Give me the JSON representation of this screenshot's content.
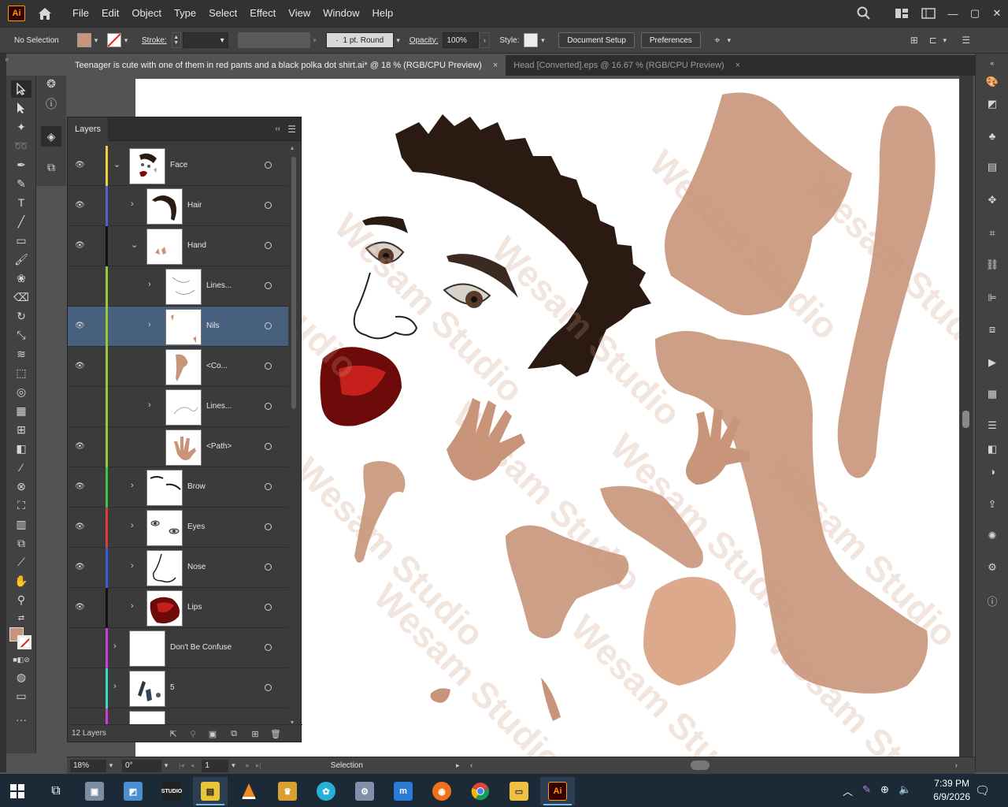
{
  "menubar": {
    "app_logo": "Ai",
    "items": [
      "File",
      "Edit",
      "Object",
      "Type",
      "Select",
      "Effect",
      "View",
      "Window",
      "Help"
    ]
  },
  "controlbar": {
    "selection_label": "No Selection",
    "fill_color": "#c8957a",
    "stroke_label": "Stroke:",
    "stroke_profile": "1 pt. Round",
    "opacity_label": "Opacity:",
    "opacity_value": "100%",
    "style_label": "Style:",
    "document_setup": "Document Setup",
    "preferences": "Preferences"
  },
  "tabs": [
    {
      "label": "Teenager is cute with one of them in red pants and a black polka dot shirt.ai* @ 18 % (RGB/CPU Preview)",
      "close": "×"
    },
    {
      "label": "Head [Converted].eps @ 16.67 % (RGB/CPU Preview)",
      "close": "×"
    }
  ],
  "layers_panel": {
    "title": "Layers",
    "footer_count": "12 Layers",
    "rows": [
      {
        "name": "Face"
      },
      {
        "name": "Hair"
      },
      {
        "name": "Hand"
      },
      {
        "name": "Lines..."
      },
      {
        "name": "Nils"
      },
      {
        "name": "<Co..."
      },
      {
        "name": "Lines..."
      },
      {
        "name": "<Path>"
      },
      {
        "name": "Brow"
      },
      {
        "name": "Eyes"
      },
      {
        "name": "Nose"
      },
      {
        "name": "Lips"
      },
      {
        "name": "Don't Be Confuse"
      },
      {
        "name": "5"
      }
    ]
  },
  "statusbar": {
    "zoom": "18%",
    "rotation": "0°",
    "artboard_number": "1",
    "tool_name": "Selection"
  },
  "watermark": "Wesam Studio",
  "colors": {
    "skin": "#c8957a",
    "hair": "#2a1a12",
    "lips": "#7a0c0c",
    "selection": "#46607e",
    "accent_ai": "#ff9a00"
  },
  "taskbar": {
    "time": "7:39 PM",
    "date": "6/9/2026",
    "active_app": "Ai"
  }
}
